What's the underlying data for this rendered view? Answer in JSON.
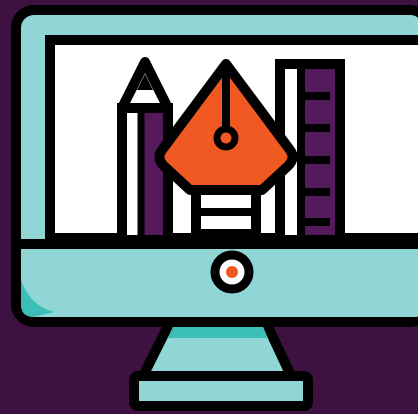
{
  "illustration": {
    "subject": "desktop-monitor-with-design-tools-icon",
    "icons": [
      "monitor-icon",
      "pencil-icon",
      "pen-nib-icon",
      "ruler-icon",
      "power-button-icon"
    ],
    "colors": {
      "background": "#3d1140",
      "outline": "#000000",
      "monitor_teal": "#8fd6d4",
      "monitor_teal_dark": "#3bbdb8",
      "screen_white": "#ffffff",
      "pen_nib_orange": "#f05a22",
      "purple_accent": "#551a5b",
      "power_dot": "#f05a22"
    }
  }
}
